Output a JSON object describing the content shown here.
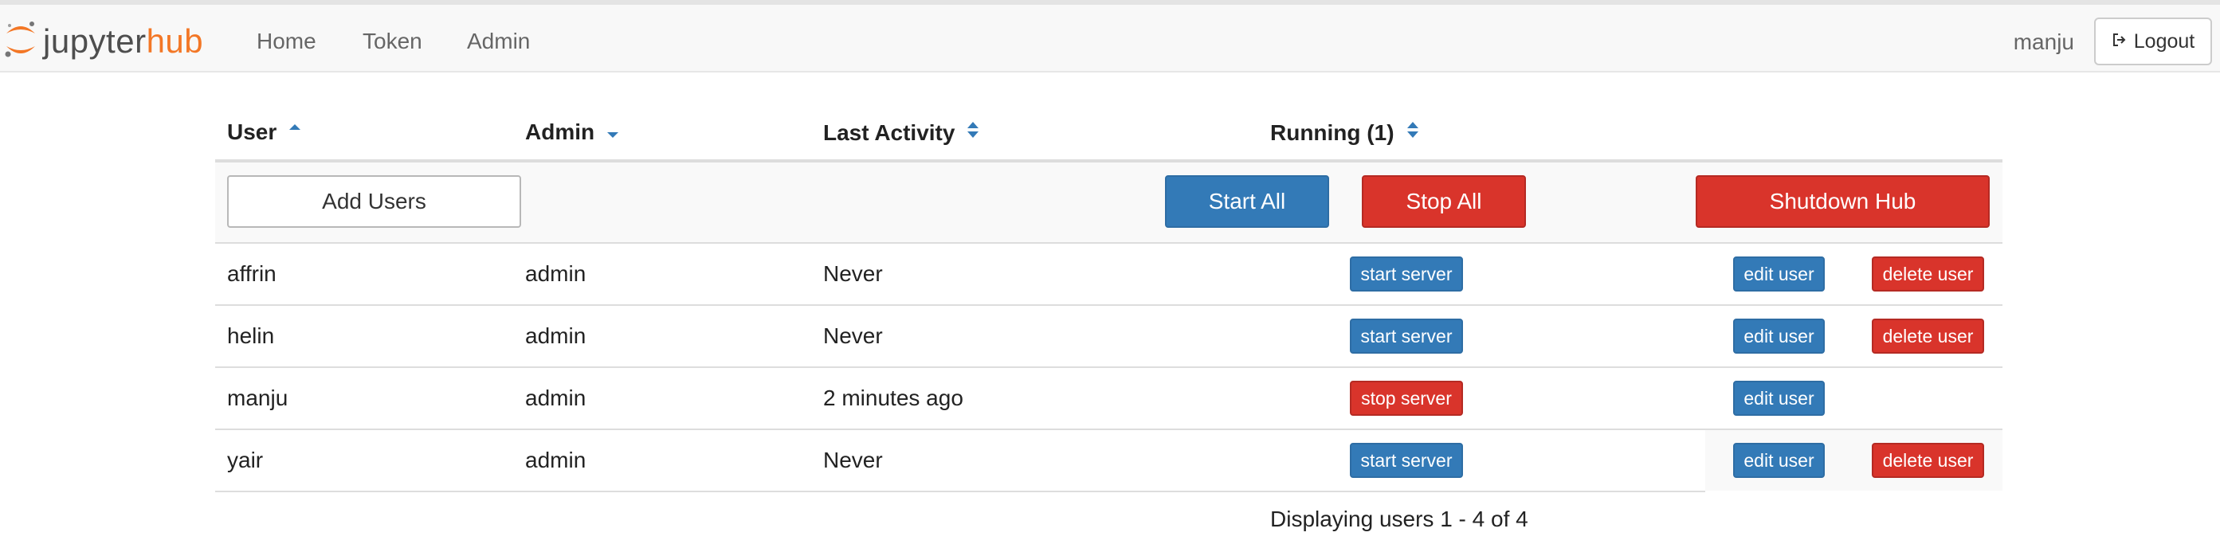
{
  "nav": {
    "brand_jupyter": "jupyter",
    "brand_hub": "hub",
    "links": [
      "Home",
      "Token",
      "Admin"
    ],
    "username": "manju",
    "logout_label": "Logout"
  },
  "table": {
    "headers": {
      "user": "User",
      "admin": "Admin",
      "last_activity": "Last Activity",
      "running": "Running (1)"
    },
    "sort": {
      "user": "ascending",
      "admin": "descending",
      "last_activity": "unsorted",
      "running": "unsorted"
    },
    "controls": {
      "add_users": "Add Users",
      "start_all": "Start All",
      "stop_all": "Stop All",
      "shutdown_hub": "Shutdown Hub"
    },
    "rows": [
      {
        "name": "affrin",
        "admin": "admin",
        "last_activity": "Never",
        "server_action": "start server",
        "edit": "edit user",
        "delete": "delete user"
      },
      {
        "name": "helin",
        "admin": "admin",
        "last_activity": "Never",
        "server_action": "start server",
        "edit": "edit user",
        "delete": "delete user"
      },
      {
        "name": "manju",
        "admin": "admin",
        "last_activity": "2 minutes ago",
        "server_action": "stop server",
        "edit": "edit user",
        "delete": ""
      },
      {
        "name": "yair",
        "admin": "admin",
        "last_activity": "Never",
        "server_action": "start server",
        "edit": "edit user",
        "delete": "delete user"
      }
    ]
  },
  "footer": {
    "pagination_text": "Displaying users 1 - 4 of 4"
  },
  "colors": {
    "primary": "#337ab7",
    "danger": "#d9342b",
    "brand_orange": "#f37726",
    "sort_active": "#337ab7"
  },
  "icons": {
    "logo": "jupyter-logo-icon",
    "logout": "sign-out-icon",
    "sort_asc": "caret-up-icon",
    "sort_desc": "caret-down-icon",
    "sort_both": "sort-icon"
  }
}
